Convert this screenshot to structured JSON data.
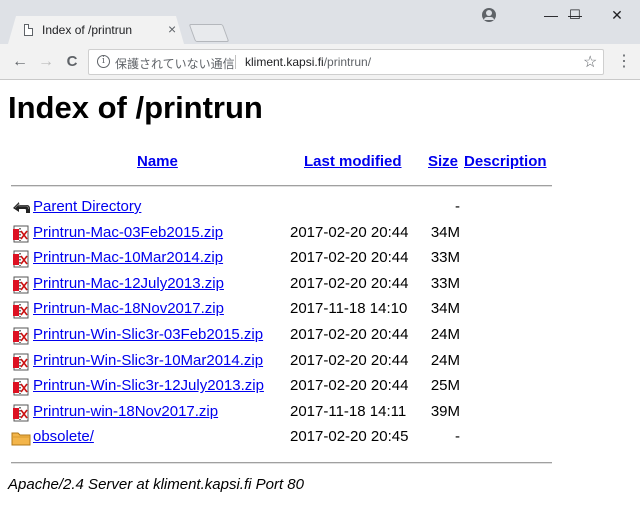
{
  "browser": {
    "tab_title": "Index of /printrun",
    "tab_close": "×",
    "security_text": "保護されていない通信",
    "url_host": "kliment.kapsi.fi",
    "url_path": "/printrun/",
    "back": "←",
    "forward": "→",
    "reload": "C",
    "star": "☆",
    "menu": "⋮",
    "minimize": "—",
    "maximize": "☐",
    "close": "✕"
  },
  "page": {
    "heading": "Index of /printrun",
    "columns": {
      "name": "Name",
      "last_modified": "Last modified",
      "size": "Size",
      "description": "Description"
    },
    "rows": [
      {
        "icon": "back-icon",
        "name": "Parent Directory",
        "date": "",
        "size": "-"
      },
      {
        "icon": "zip-icon",
        "name": "Printrun-Mac-03Feb2015.zip",
        "date": "2017-02-20 20:44",
        "size": "34M"
      },
      {
        "icon": "zip-icon",
        "name": "Printrun-Mac-10Mar2014.zip",
        "date": "2017-02-20 20:44",
        "size": "33M"
      },
      {
        "icon": "zip-icon",
        "name": "Printrun-Mac-12July2013.zip",
        "date": "2017-02-20 20:44",
        "size": "33M"
      },
      {
        "icon": "zip-icon",
        "name": "Printrun-Mac-18Nov2017.zip",
        "date": "2017-11-18 14:10",
        "size": "34M"
      },
      {
        "icon": "zip-icon",
        "name": "Printrun-Win-Slic3r-03Feb2015.zip",
        "date": "2017-02-20 20:44",
        "size": "24M"
      },
      {
        "icon": "zip-icon",
        "name": "Printrun-Win-Slic3r-10Mar2014.zip",
        "date": "2017-02-20 20:44",
        "size": "24M"
      },
      {
        "icon": "zip-icon",
        "name": "Printrun-Win-Slic3r-12July2013.zip",
        "date": "2017-02-20 20:44",
        "size": "25M"
      },
      {
        "icon": "zip-icon",
        "name": "Printrun-win-18Nov2017.zip",
        "date": "2017-11-18 14:11",
        "size": "39M"
      },
      {
        "icon": "folder-icon",
        "name": "obsolete/",
        "date": "2017-02-20 20:45",
        "size": "-"
      }
    ],
    "footer": "Apache/2.4 Server at kliment.kapsi.fi Port 80"
  },
  "colors": {
    "link": "#0000ee",
    "chrome_bg": "#dee1e6",
    "toolbar_bg": "#f2f2f2"
  }
}
